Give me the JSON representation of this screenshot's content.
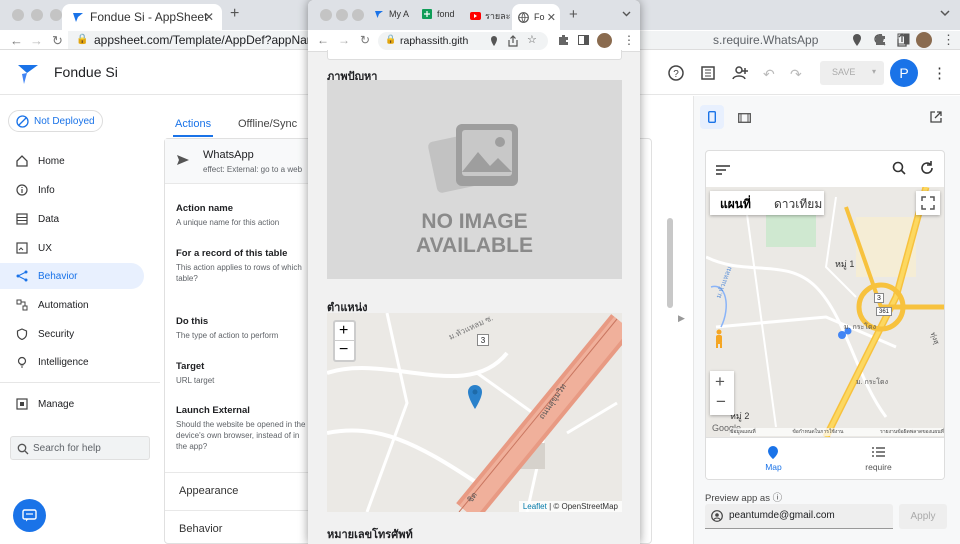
{
  "browser_main": {
    "tabs": [
      {
        "title": "Fondue Si - AppSheet"
      }
    ],
    "url": "appsheet.com/Template/AppDef?appName=Fond",
    "url_tail": "s.require.WhatsApp"
  },
  "app_header": {
    "app_name": "Fondue Si",
    "save_label": "SAVE",
    "avatar_letter": "P"
  },
  "left_nav": {
    "deploy_status": "Not Deployed",
    "items": [
      {
        "label": "Home"
      },
      {
        "label": "Info"
      },
      {
        "label": "Data"
      },
      {
        "label": "UX"
      },
      {
        "label": "Behavior"
      },
      {
        "label": "Automation"
      },
      {
        "label": "Security"
      },
      {
        "label": "Intelligence"
      },
      {
        "label": "Manage"
      }
    ],
    "search_placeholder": "Search for help"
  },
  "editor": {
    "tabs": [
      {
        "label": "Actions"
      },
      {
        "label": "Offline/Sync"
      }
    ],
    "action_title": "WhatsApp",
    "action_subtitle": "effect: External: go to a web",
    "fields": [
      {
        "title": "Action name",
        "desc": "A unique name for this action"
      },
      {
        "title": "For a record of this table",
        "desc": "This action applies to rows of which table?"
      },
      {
        "title": "Do this",
        "desc": "The type of action to perform"
      },
      {
        "title": "Target",
        "desc": "URL target"
      },
      {
        "title": "Launch External",
        "desc": "Should the website be opened in the device's own browser, instead of in the app?"
      }
    ],
    "sections": [
      {
        "label": "Appearance"
      },
      {
        "label": "Behavior"
      }
    ]
  },
  "popup": {
    "tabs": [
      {
        "title": "My A"
      },
      {
        "title": "fond"
      },
      {
        "title": "รายละ"
      },
      {
        "title": "Fo"
      }
    ],
    "url": "raphassith.gith",
    "section1": "ภาพปัญหา",
    "no_image_line1": "NO IMAGE",
    "no_image_line2": "AVAILABLE",
    "section2": "ตำแหน่ง",
    "map_labels": {
      "road1": "ม.หัวแหลม ซ.",
      "road2": "ถนนสุขุมวิท",
      "shield": "3",
      "bottom_road": "ชิต"
    },
    "zoom_in": "+",
    "zoom_out": "−",
    "attr_leaflet": "Leaflet",
    "attr_rest": "| © OpenStreetMap",
    "section3": "หมายเลขโทรศัพท์"
  },
  "preview": {
    "map_tabs": [
      {
        "label": "แผนที่"
      },
      {
        "label": "ดาวเทียม"
      }
    ],
    "map_labels": {
      "moo1": "หมู่ 1",
      "moo2": "หมู่ 2",
      "soi1": "ม. กระโดง",
      "soi2": "ม. กระโดง",
      "shield1": "3",
      "shield2": "361",
      "road_s": "ม.หัวแหลม",
      "road_r": "ทุ่งสุ"
    },
    "attribution": [
      "ข้อมูลแผนที่",
      "ข้อกำหนดในการใช้งาน",
      "รายงานข้อผิดพลาดของแผนที่"
    ],
    "google": "Google",
    "bottom_nav": [
      {
        "label": "Map"
      },
      {
        "label": "require"
      }
    ],
    "preview_as_label": "Preview app as",
    "email": "peantumde@gmail.com",
    "apply_label": "Apply"
  },
  "colors": {
    "accent": "#1a73e8",
    "selected_bg": "#e8f0fe",
    "avatar": "#1a73e8"
  }
}
